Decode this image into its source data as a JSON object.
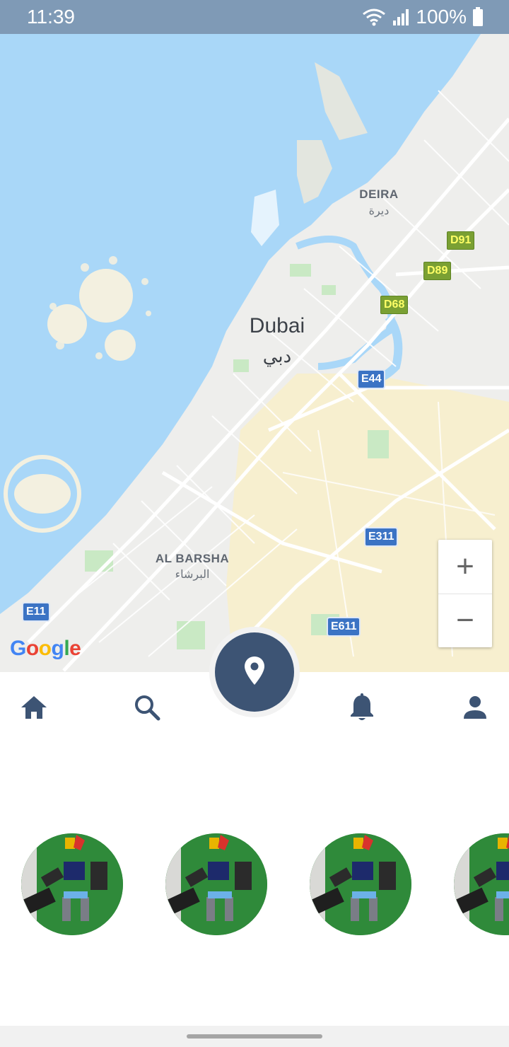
{
  "status_bar": {
    "time": "11:39",
    "battery": "100%",
    "icons": [
      "wifi-icon",
      "signal-icon",
      "battery-icon"
    ]
  },
  "map": {
    "labels": {
      "deira": "DEIRA",
      "deira_ar": "ديرة",
      "dubai": "Dubai",
      "dubai_ar": "دبي",
      "al_barsha": "AL BARSHA",
      "al_barsha_ar": "البرشاء"
    },
    "road_badges": {
      "d91": "D91",
      "d89": "D89",
      "d68": "D68",
      "e44": "E44",
      "e311": "E311",
      "e11": "E11",
      "e611": "E611"
    },
    "attribution": {
      "g": "G",
      "o1": "o",
      "o2": "o",
      "g2": "g",
      "l": "l",
      "e": "e"
    },
    "zoom_in": "+",
    "zoom_out": "−"
  },
  "bottom_nav": {
    "items": [
      "home-icon",
      "search-icon",
      "location-pin-icon",
      "bell-icon",
      "person-icon"
    ],
    "accent_color": "#3d5474"
  },
  "avatars": {
    "count_visible": 4,
    "icons": [
      "robot-photo",
      "robot-photo",
      "robot-photo",
      "robot-photo"
    ]
  }
}
